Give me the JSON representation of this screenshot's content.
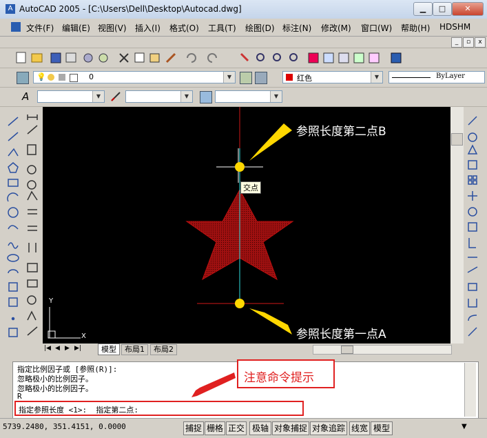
{
  "window": {
    "title": "AutoCAD 2005 - [C:\\Users\\Dell\\Desktop\\Autocad.dwg]"
  },
  "menu": [
    "文件(F)",
    "编辑(E)",
    "视图(V)",
    "插入(I)",
    "格式(O)",
    "工具(T)",
    "绘图(D)",
    "标注(N)",
    "修改(M)",
    "窗口(W)",
    "帮助(H)",
    "HDSHM"
  ],
  "layers": {
    "current": "0",
    "color": "红色",
    "linetype": "ByLayer"
  },
  "drawing": {
    "tooltip": "交点",
    "annotation_b": "参照长度第二点B",
    "annotation_a": "参照长度第一点A",
    "ucs_y": "Y",
    "ucs_x": "X",
    "star_color": "#a01010",
    "marker_color": "#ffd700"
  },
  "layout_tabs": [
    "模型",
    "布局1",
    "布局2"
  ],
  "command": {
    "lines": [
      "指定比例因子或 [参照(R)]:",
      "忽略极小的比例因子。",
      "忽略极小的比例因子。",
      "R"
    ],
    "prompt": "指定参照长度 <1>:  指定第二点:",
    "callout": "注意命令提示"
  },
  "status": {
    "coords": "5739.2480, 351.4151, 0.0000",
    "toggles": [
      "捕捉",
      "栅格",
      "正交",
      "极轴",
      "对象捕捉",
      "对象追踪",
      "线宽",
      "模型"
    ]
  },
  "colors": {
    "callout_red": "#e02020",
    "annotation_arrow": "#ffd700"
  }
}
